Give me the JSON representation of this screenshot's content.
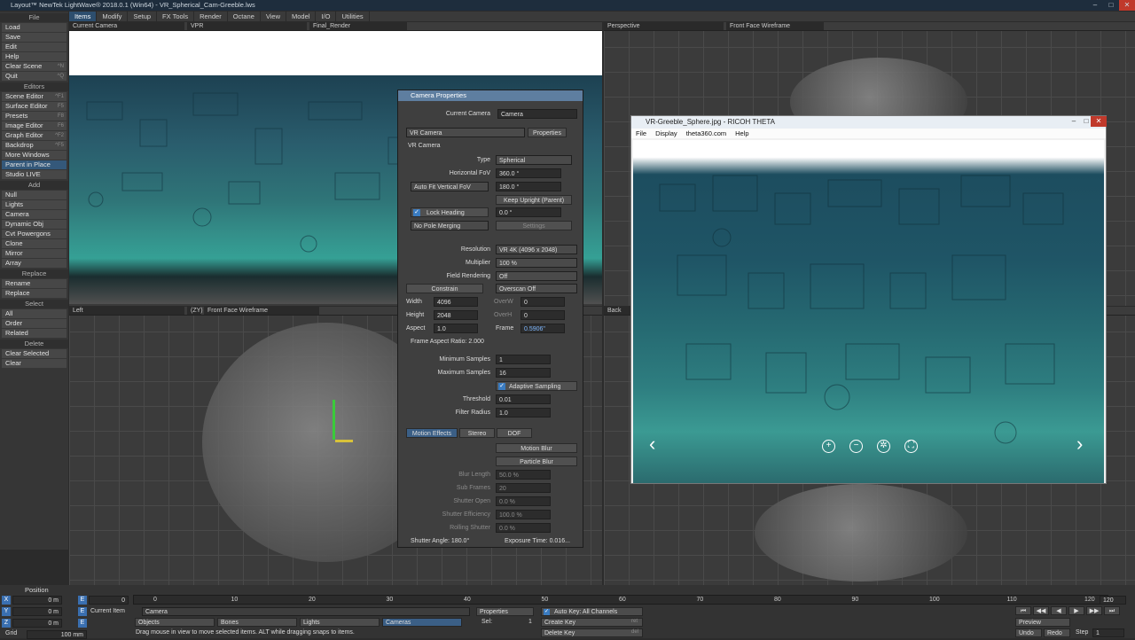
{
  "window": {
    "title": "Layout™ NewTek LightWave® 2018.0.1 (Win64) - VR_Spherical_Cam-Greeble.lws"
  },
  "menubar": {
    "tabs": [
      "Items",
      "Modify",
      "Setup",
      "FX Tools",
      "Render",
      "Octane",
      "View",
      "Model",
      "I/O",
      "Utilities"
    ]
  },
  "sidebar": {
    "sections": [
      {
        "header": "File",
        "items": [
          {
            "label": "Load"
          },
          {
            "label": "Save"
          },
          {
            "label": "Edit"
          },
          {
            "label": "Help"
          },
          {
            "label": "Clear Scene",
            "key": "^N"
          },
          {
            "label": "Quit",
            "key": "^Q"
          }
        ]
      },
      {
        "header": "Editors",
        "items": [
          {
            "label": "Scene Editor",
            "key": "^F1"
          },
          {
            "label": "Surface Editor",
            "key": "F5"
          },
          {
            "label": "Presets",
            "key": "F8"
          },
          {
            "label": "Image Editor",
            "key": "F6"
          },
          {
            "label": "Graph Editor",
            "key": "^F2"
          },
          {
            "label": "Backdrop",
            "key": "^F5"
          },
          {
            "label": "More Windows"
          },
          {
            "label": "Parent in Place"
          },
          {
            "label": "Studio LIVE"
          }
        ]
      },
      {
        "header": "Add",
        "items": [
          {
            "label": "Null"
          },
          {
            "label": "Lights"
          },
          {
            "label": "Camera"
          },
          {
            "label": "Dynamic Obj"
          },
          {
            "label": "Cvt Powergons"
          },
          {
            "label": "Clone"
          },
          {
            "label": "Mirror"
          },
          {
            "label": "Array"
          }
        ]
      },
      {
        "header": "Replace",
        "items": [
          {
            "label": "Rename"
          },
          {
            "label": "Replace"
          }
        ]
      },
      {
        "header": "Select",
        "items": [
          {
            "label": "All"
          },
          {
            "label": "Order"
          },
          {
            "label": "Related"
          }
        ]
      },
      {
        "header": "Delete",
        "items": [
          {
            "label": "Clear Selected"
          },
          {
            "label": "Clear"
          }
        ]
      }
    ]
  },
  "viewports": {
    "top_left": {
      "camera": "Current Camera",
      "mode": "VPR",
      "render": "Final_Render"
    },
    "top_right": {
      "view": "Perspective",
      "shading": "Front Face Wireframe"
    },
    "bottom_left": {
      "view": "Left",
      "axes": "(ZY)",
      "shading": "Front Face Wireframe"
    },
    "bottom_right": {
      "view": "Back"
    }
  },
  "camera_props": {
    "title": "Camera Properties",
    "current_camera_label": "Current Camera",
    "current_camera": "Camera",
    "camera_type": "VR Camera",
    "properties_btn": "Properties",
    "section": "VR Camera",
    "type_label": "Type",
    "type": "Spherical",
    "hfov_label": "Horizontal FoV",
    "hfov": "360.0 °",
    "auto_fit": "Auto Fit Vertical FoV",
    "vfov": "180.0 °",
    "keep_upright": "Keep Upright (Parent)",
    "lock_heading": "Lock Heading",
    "lock_value": "0.0 °",
    "pole_merging": "No Pole Merging",
    "settings": "Settings",
    "resolution_label": "Resolution",
    "resolution": "VR 4K (4096 x 2048)",
    "multiplier_label": "Multiplier",
    "multiplier": "100 %",
    "field_label": "Field Rendering",
    "field": "Off",
    "constrain": "Constrain",
    "overscan": "Overscan Off",
    "width_label": "Width",
    "width": "4096",
    "height_label": "Height",
    "height": "2048",
    "aspect_label": "Aspect",
    "aspect": "1.0",
    "overw_label": "OverW",
    "overw": "0",
    "overh_label": "OverH",
    "overh": "0",
    "frame_label": "Frame",
    "frame": "0.5906\"",
    "frame_aspect": "Frame Aspect Ratio: 2.000",
    "min_samples_label": "Minimum Samples",
    "min_samples": "1",
    "max_samples_label": "Maximum Samples",
    "max_samples": "16",
    "adaptive": "Adaptive Sampling",
    "threshold_label": "Threshold",
    "threshold": "0.01",
    "filter_label": "Filter Radius",
    "filter": "1.0",
    "tabs": [
      "Motion Effects",
      "Stereo",
      "DOF"
    ],
    "motion_blur": "Motion Blur",
    "particle_blur": "Particle Blur",
    "blur_length_label": "Blur Length",
    "blur_length": "50.0 %",
    "sub_frames_label": "Sub Frames",
    "sub_frames": "20",
    "shutter_open_label": "Shutter Open",
    "shutter_open": "0.0 %",
    "shutter_eff_label": "Shutter Efficiency",
    "shutter_eff": "100.0 %",
    "rolling_label": "Rolling Shutter",
    "rolling": "0.0 %",
    "shutter_angle": "Shutter Angle: 180.0°",
    "exposure": "Exposure Time: 0.016..."
  },
  "theta": {
    "title": "VR-Greeble_Sphere.jpg - RICOH THETA",
    "menu": [
      "File",
      "Display",
      "theta360.com",
      "Help"
    ]
  },
  "timeline": {
    "position_label": "Position",
    "axes": [
      {
        "axis": "X",
        "value": "0 m"
      },
      {
        "axis": "Y",
        "value": "0 m"
      },
      {
        "axis": "Z",
        "value": "0 m"
      }
    ],
    "grid_label": "Grid",
    "grid_value": "100 mm",
    "frame_value": "0",
    "current_frame": "0",
    "ticks": [
      "0",
      "10",
      "20",
      "30",
      "40",
      "50",
      "60",
      "70",
      "80",
      "90",
      "100",
      "110",
      "120"
    ],
    "end_frame": "120",
    "current_item_label": "Current Item",
    "current_item": "Camera",
    "properties": "Properties",
    "auto_key": "Auto Key: All Channels",
    "create_key": "Create Key",
    "create_key_shortcut": "ret",
    "delete_key": "Delete Key",
    "delete_key_shortcut": "del",
    "sel_label": "Sel:",
    "sel_value": "1",
    "filters": [
      "Objects",
      "Bones",
      "Lights",
      "Cameras"
    ],
    "status": "Drag mouse in view to move selected items. ALT while dragging snaps to items.",
    "preview": "Preview",
    "undo": "Undo",
    "redo": "Redo",
    "step_label": "Step",
    "step": "1"
  }
}
